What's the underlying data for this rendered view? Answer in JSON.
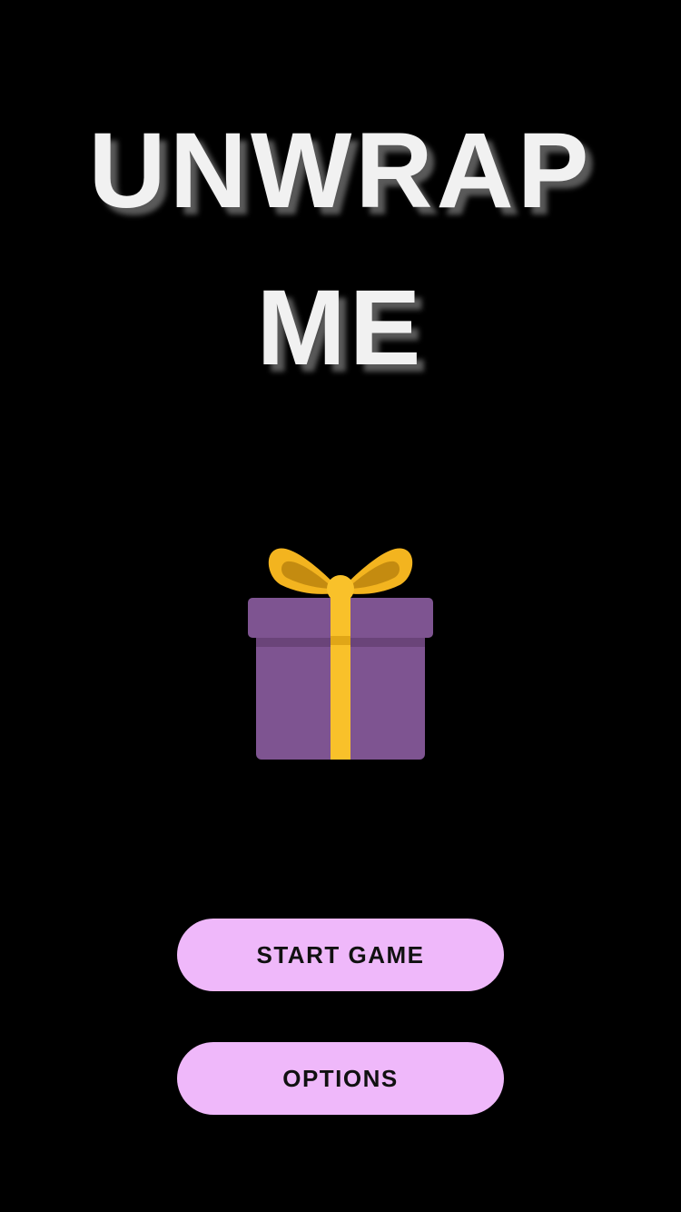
{
  "title": {
    "line1": "UNWRAP",
    "line2": "ME"
  },
  "gift": {
    "icon": "gift-icon",
    "colors": {
      "box": "#7e5491",
      "lid": "#7e5491",
      "ribbon": "#f9c12a",
      "bow": "#f3b41f"
    }
  },
  "menu": {
    "start_label": "START GAME",
    "options_label": "OPTIONS"
  },
  "colors": {
    "background": "#000000",
    "title_text": "#f1f1f1",
    "button_bg": "#efb8fa",
    "button_text": "#111111"
  }
}
